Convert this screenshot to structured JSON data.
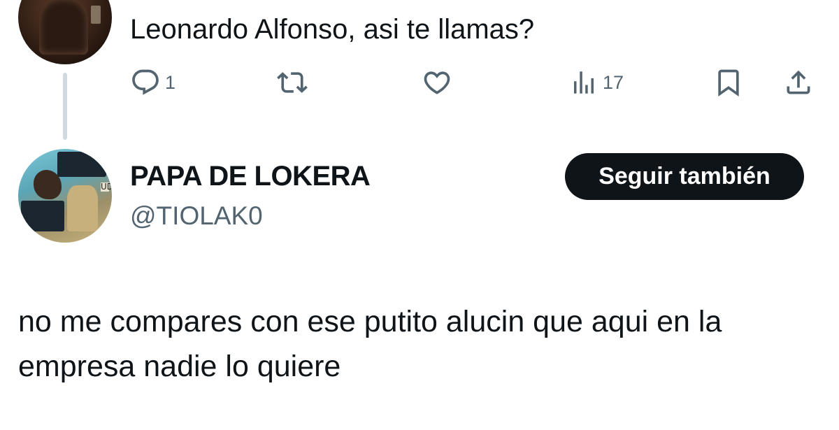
{
  "parent_tweet": {
    "text": "Leonardo Alfonso, asi te llamas?",
    "actions": {
      "reply_count": "1",
      "retweet_count": "",
      "like_count": "",
      "views_count": "17"
    },
    "icons": [
      "reply-icon",
      "retweet-icon",
      "like-icon",
      "views-icon",
      "bookmark-icon",
      "share-icon"
    ]
  },
  "reply_tweet": {
    "author_name": "PAPA DE LOKERA",
    "author_handle": "@TIOLAK0",
    "follow_label": "Seguir también",
    "avatar_letters": "UDF",
    "text": "no me compares con ese putito alucin que aqui en la empresa nadie lo quiere"
  },
  "colors": {
    "text": "#0f1419",
    "muted": "#536471",
    "thread_line": "#cfd9de",
    "button_bg": "#0f1419",
    "button_text": "#ffffff"
  }
}
